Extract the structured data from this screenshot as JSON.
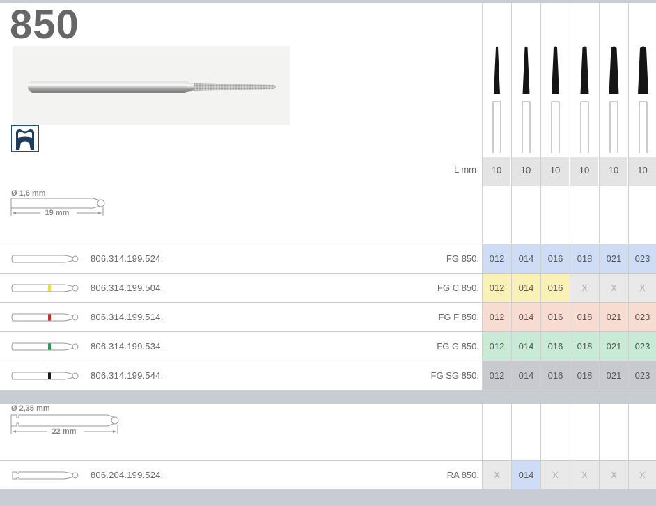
{
  "product": {
    "number": "850",
    "length_label": "L mm",
    "lengths": [
      "10",
      "10",
      "10",
      "10",
      "10",
      "10"
    ]
  },
  "colors": {
    "blue": "#cfdcf5",
    "yellow": "#f9f1b6",
    "red": "#f9dcd1",
    "green": "#c9ebd6",
    "black": "#c8cad0",
    "na": "#e9e9ea",
    "band": "#c8ccd3"
  },
  "icons": {
    "tooth": "tooth-icon",
    "instrument": "bur-photo"
  },
  "fg_section": {
    "diameter": "Ø 1,6 mm",
    "length": "19 mm",
    "rows": [
      {
        "ring": "none",
        "code": "806.314.199.524.",
        "type": "FG 850.",
        "tint": "blue",
        "sizes": [
          "012",
          "014",
          "016",
          "018",
          "021",
          "023"
        ]
      },
      {
        "ring": "yellow",
        "code": "806.314.199.504.",
        "type": "FG C 850.",
        "tint": "yellow",
        "sizes": [
          "012",
          "014",
          "016",
          "X",
          "X",
          "X"
        ]
      },
      {
        "ring": "red",
        "code": "806.314.199.514.",
        "type": "FG F 850.",
        "tint": "red",
        "sizes": [
          "012",
          "014",
          "016",
          "018",
          "021",
          "023"
        ]
      },
      {
        "ring": "green",
        "code": "806.314.199.534.",
        "type": "FG G 850.",
        "tint": "green",
        "sizes": [
          "012",
          "014",
          "016",
          "018",
          "021",
          "023"
        ]
      },
      {
        "ring": "black",
        "code": "806.314.199.544.",
        "type": "FG SG 850.",
        "tint": "black",
        "sizes": [
          "012",
          "014",
          "016",
          "018",
          "021",
          "023"
        ]
      }
    ]
  },
  "ra_section": {
    "diameter": "Ø 2,35 mm",
    "length": "22 mm",
    "rows": [
      {
        "code": "806.204.199.524.",
        "type": "RA 850.",
        "sizes": [
          "X",
          "014",
          "X",
          "X",
          "X",
          "X"
        ],
        "tints": [
          "na",
          "blue",
          "na",
          "na",
          "na",
          "na"
        ]
      }
    ]
  }
}
